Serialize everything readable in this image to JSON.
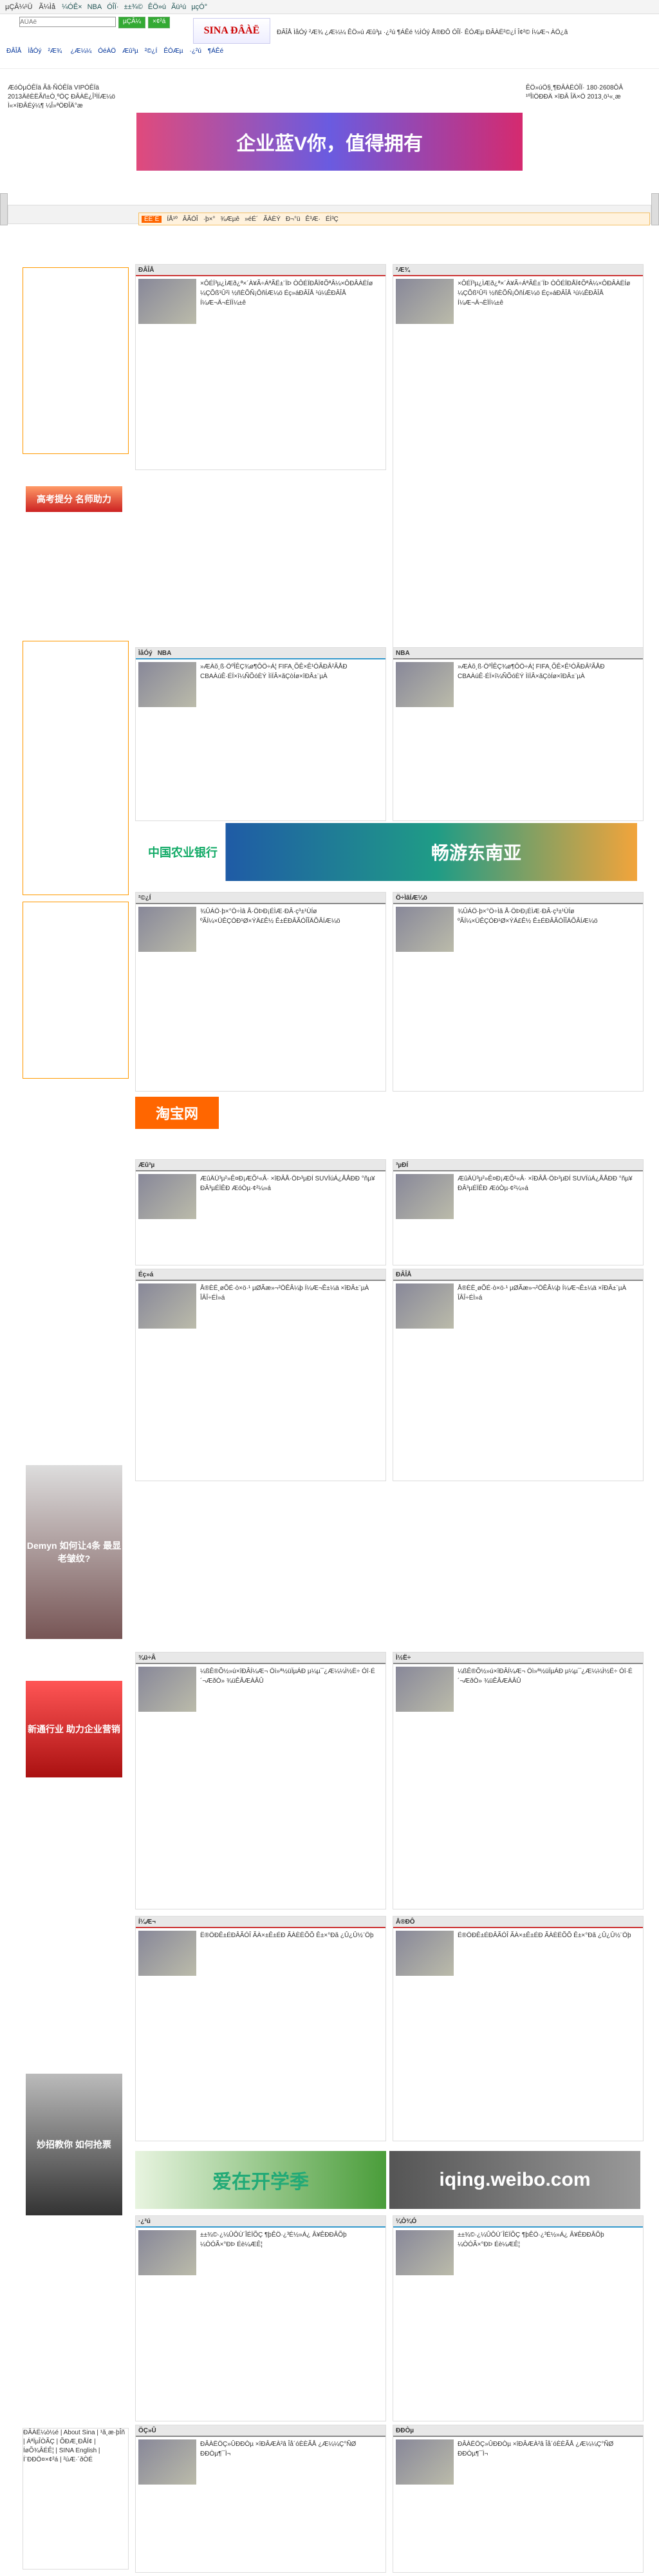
{
  "topbar": {
    "login": "µÇÂ¼¹Ü",
    "item2": "Ã¼Ìå",
    "nav": [
      "¼ÓÊ×",
      "NBA",
      "ÓÎÏ·",
      "±±¾©",
      "ÊÖ»ú",
      "Ãü¹ú",
      "µçÓ°"
    ]
  },
  "search": {
    "placeholder": "ÃÜÂë",
    "go": "µÇÂ¼",
    "register": "×¢²á"
  },
  "logo": "SINA ÐÂÀË",
  "header_links": "ÐÂÎÅ ÌåÓý ²Æ¾­ ¿Æ¼¼ ÊÖ»ú Æû³µ ·¿²ú ¶ÁÊé ½ÌÓý Å®ÐÔ ÓÎÏ· ÊÓÆµ ÐÂÀË²©¿Í Î¢²© Í¼Æ¬ ÀÖ¿â",
  "channels": [
    "ÐÂÎÅ",
    "ÌåÓý",
    "²Æ¾­",
    "¿Æ¼¼",
    "ÓéÀÖ",
    "Æû³µ",
    "²©¿Í",
    "ÊÓÆµ",
    "·¿²ú",
    "¶ÁÊé"
  ],
  "left_text": "ÆóÒµÓÊÏä Ãâ·ÑÓÊÏä VIPÓÊÏä 2013ÄêÈËÃñ±Ò¸ºÖÇ ÐÂÀË¿Î³ÌÍÆ¼ö Ì«×îÐÂÉý¼¶ ¼Î»ªÖÐÎÄ°æ",
  "banner_text": "ÆóÒµÀ¶V Äã, ÖµµÃÓµÓÐ",
  "banner_cn": "企业蓝V你，值得拥有",
  "right_text": "ÊÖ»úÖ§¸¶ÐÂÀËÓÎÏ· 180·2608ÔÂ ¹ºÎïÖÐÐÄ ×îÐÂ ÎÄ×Ö 2013¸ö¹«¸æ",
  "pink_bar": [
    "ÈÈ´Ê",
    "ÍÅ¹º",
    "ÂÃÓÎ",
    "·þ×°",
    "¾Æµê",
    "»éÉ´",
    "ÃÀÈÝ",
    "Ð¬°ü",
    "Ê³Æ·",
    "ÉÌ³Ç"
  ],
  "sections": [
    {
      "title": "ÐÂÎÅ",
      "sub": "²Æ¾­",
      "text": "×ÔÉÏ³µ¿ÌÆð¿ª×´À¥Ã÷ÁªÃË±¨ÏÞ ÒÔÉÏÐÅÏ¢ÕªÂ¼×ÔÐÂÀËÍø ¼ÇÕß¹Û²ì ½ñÈÕÑ¡ÔñÍÆ¼ö Éç»áÐÂÎÅ ¹ú¼ÊÐÂÎÅ Í¼Æ¬Ä¬ÈÏÍ¼±ê"
    },
    {
      "title": "ÌåÓý",
      "sub": "NBA",
      "text": "»ÆÀõ¸ß·ÖºÎÊÇ¾ø¶ÔÖ÷Á¦ FIFA¸ÕÊ×Ê¹ÓÃÐÂ²ÃÅÐ CBAÀúÊ·ÉÏ×î¼ÑÕóÈÝ ÌìÏÂ×ãÇòÍø×îÐÂ±¨µÀ"
    },
    {
      "title": "²©¿Í",
      "sub": "Ö÷ÌâÍÆ¼ö",
      "text": "¾ÛÁÖ·þ×°Ö÷Ìâ Å·ÖÞÐ¡ÉÌÆ·ÐÂ·ç³±¹ÙÍø ºÃÍ¼×ÜÊÇÓÐ¹Ø×ÝÄ£Ê½ Ê±ÉÐÂÃÓÎÎÄÕÂÍÆ¼ö"
    },
    {
      "title": "Æû³µ",
      "sub": "³µÐÍ",
      "text": "ÆûÄÜ³µ²»Ê¤Ð¡ÆÕ¹«Â· ×îÐÂÅ·ÖÞ³µÐÍ SUVÏúÁ¿ÅÅÐÐ °ñµ¥ ÐÂ³µÉÏÊÐ ÆóÒµ·¢²¼»á"
    },
    {
      "title": "Éç»á",
      "sub": "ÐÂÎÅ",
      "text": "Å®ÈË¸øÕÉ·ò×ö·¹ µØÃæ»¬²ÖÊÂ¼þ Í¼Æ¬Ê±¼ä ×îÐÂ±¨µÀ ÎÂÎ÷ÉÌ»á"
    },
    {
      "title": "¾ü÷Â",
      "sub": "Ì½Ë÷",
      "text": "¼ßÊ®Õ½»ú×îÐÂÍ¼Æ¬ Öì»ª½üÏµÁÐ µ¼µ¯¿Æ¼¼Ì½Ë÷ Óî·É´¬ÆðÒ» ¾üÊÂÆÀÂÛ"
    },
    {
      "title": "Í¼Æ¬",
      "sub": "Å®ÐÔ",
      "text": "Ë®ÖÐÊ±ÉÐÂÃÓÎ ÃÀ×±Ê±ÉÐ ÃÀÈËÕÕ Ê±×°Ðã ¿Û¿Û½¨Öþ"
    },
    {
      "title": "·¿²ú",
      "sub": "¼Ò¾Ó",
      "text": "±±¾©·¿¼ÛÔÙ´ÎÉÏÕÇ ¶þÊÖ·¿³É½»Á¿ Â¥ÊÐÐÂÕþ ¼ÒÓÃ×°ÐÞ Éè¼ÆÊ¦"
    },
    {
      "title": "ÖÇ»Û",
      "sub": "ÐÐÒµ",
      "text": "ÐÂÀËÖÇ»ÛÐÐÒµ ×îÐÂÆÀ²â Îå´óÈÈÃÅ ¿Æ¼¼Ç°ÑØ ÐÐÒµ¶¯Ì¬"
    }
  ],
  "abc_banner": {
    "bank": "中国农业银行",
    "slogan": "畅游东南亚"
  },
  "taobao": "淘宝网",
  "green_banner": "爱在开学季",
  "weibo_banner": "iqing.weibo.com",
  "left_ads": [
    "高考提分 名师助力",
    "新通行业 助力企业营销",
    "Demyn 如何让4条 最显老皱纹?",
    "妙招教你 如何抢票"
  ],
  "footer": "ÐÂÀË¼ò½é | About Sina | ¹ã¸æ·þÎñ | ÁªÏµÎÒÃÇ | ÕÐÆ¸ÐÅÏ¢ | ÍøÕ¾ÂÉÊ¦ | SINA English | Í¨ÐÐÖ¤×¢²á | ²úÆ·´ðÒÉ"
}
